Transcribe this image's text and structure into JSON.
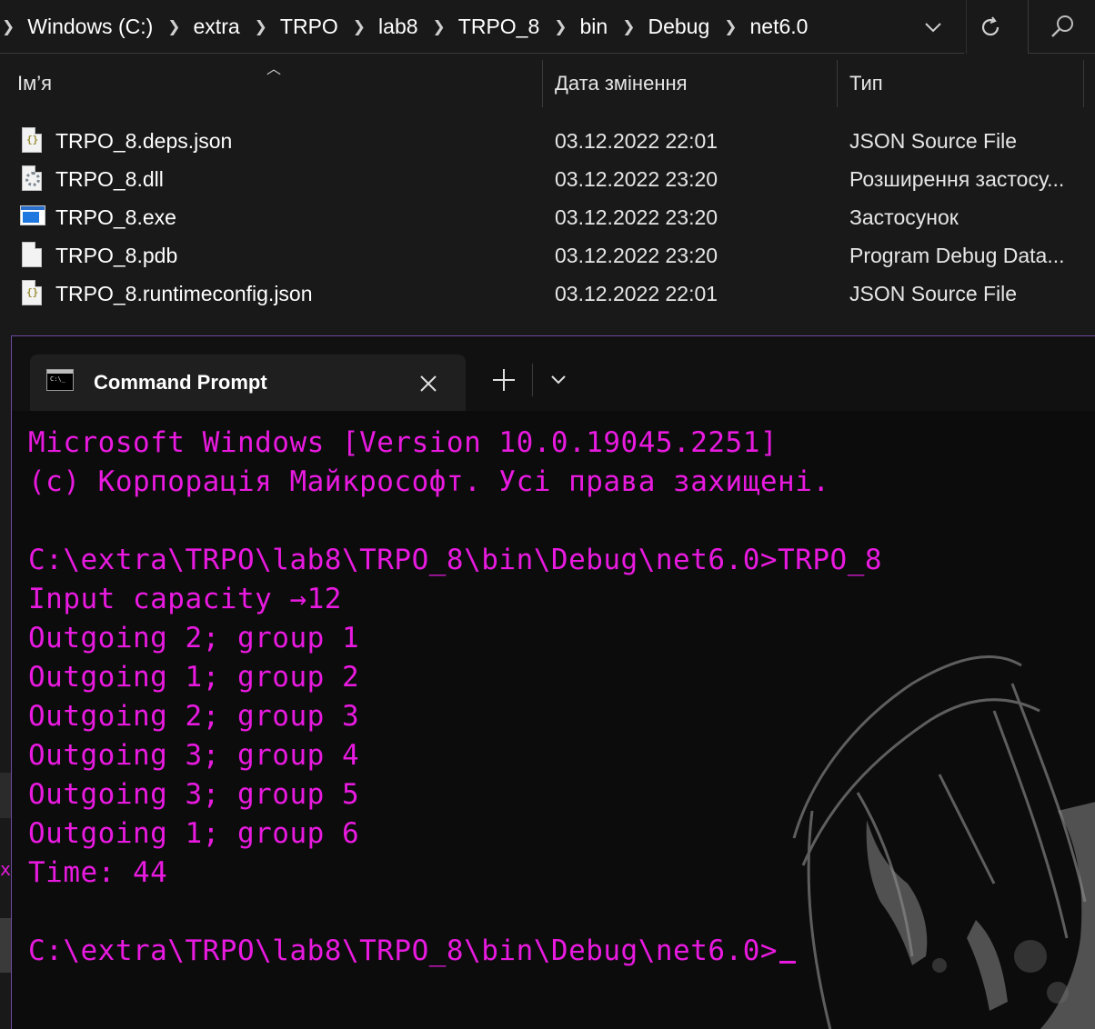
{
  "explorer": {
    "breadcrumbs": [
      "Windows (C:)",
      "extra",
      "TRPO",
      "lab8",
      "TRPO_8",
      "bin",
      "Debug",
      "net6.0"
    ],
    "columns": {
      "name": "Ім’я",
      "date": "Дата змінення",
      "type": "Тип"
    },
    "files": [
      {
        "name": "TRPO_8.deps.json",
        "date": "03.12.2022 22:01",
        "type": "JSON Source File",
        "icon": "json-file-icon"
      },
      {
        "name": "TRPO_8.dll",
        "date": "03.12.2022 23:20",
        "type": "Розширення застосу...",
        "icon": "dll-file-icon"
      },
      {
        "name": "TRPO_8.exe",
        "date": "03.12.2022 23:20",
        "type": "Застосунок",
        "icon": "exe-file-icon"
      },
      {
        "name": "TRPO_8.pdb",
        "date": "03.12.2022 23:20",
        "type": "Program Debug Data...",
        "icon": "blank-file-icon"
      },
      {
        "name": "TRPO_8.runtimeconfig.json",
        "date": "03.12.2022 22:01",
        "type": "JSON Source File",
        "icon": "json-file-icon"
      }
    ]
  },
  "terminal": {
    "tab_title": "Command Prompt",
    "tab_icon_text": "C:\\_",
    "text_color": "#e81adf",
    "lines": [
      "Microsoft Windows [Version 10.0.19045.2251]",
      "(c) Корпорація Майкрософт. Усі права захищені.",
      "",
      "C:\\extra\\TRPO\\lab8\\TRPO_8\\bin\\Debug\\net6.0>TRPO_8",
      "Input capacity →12",
      "Outgoing 2; group 1",
      "Outgoing 1; group 2",
      "Outgoing 2; group 3",
      "Outgoing 3; group 4",
      "Outgoing 3; group 5",
      "Outgoing 1; group 6",
      "Time: 44",
      "",
      "C:\\extra\\TRPO\\lab8\\TRPO_8\\bin\\Debug\\net6.0>"
    ]
  },
  "edge_fragment": "x"
}
